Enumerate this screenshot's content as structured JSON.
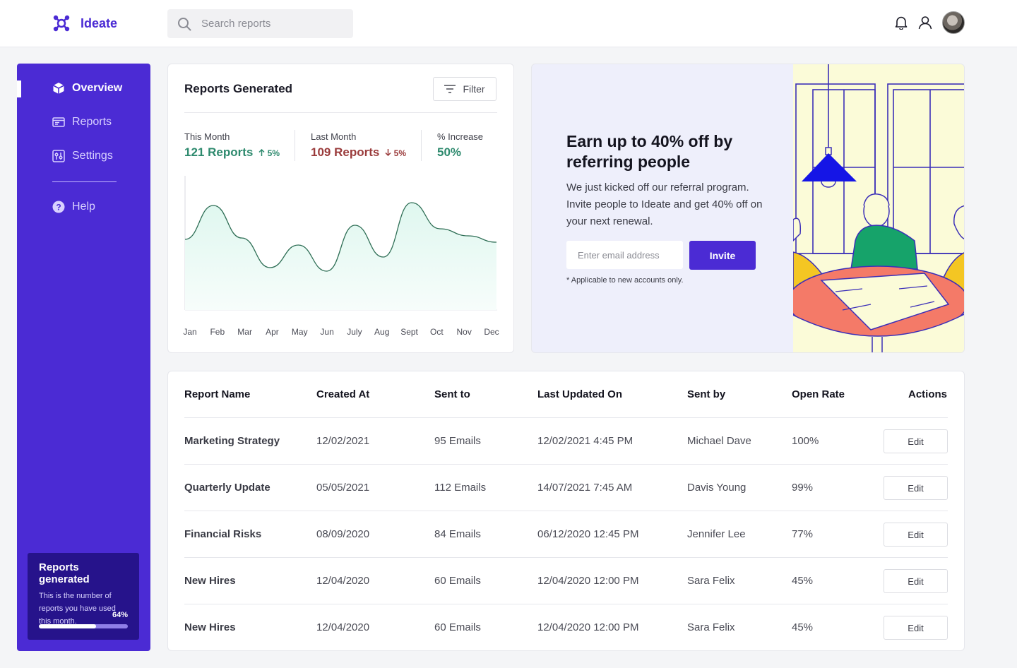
{
  "app": {
    "name": "Ideate",
    "logo_icon": "molecule-logo-icon",
    "accent": "#4b2bd4"
  },
  "search": {
    "placeholder": "Search reports",
    "icon": "search-icon"
  },
  "header_icons": [
    "bell-icon",
    "user-icon",
    "avatar"
  ],
  "sidebar": {
    "items": [
      {
        "label": "Overview",
        "icon": "cube-icon",
        "active": true
      },
      {
        "label": "Reports",
        "icon": "reports-icon",
        "active": false
      },
      {
        "label": "Settings",
        "icon": "settings-icon",
        "active": false
      },
      {
        "label": "Help",
        "icon": "help-icon",
        "active": false
      }
    ],
    "usage": {
      "title": "Reports generated",
      "description": "This is the number of reports you have used this month.",
      "percent_label": "64%",
      "percent": 64
    }
  },
  "chart_card": {
    "title": "Reports Generated",
    "filter_label": "Filter",
    "stats": [
      {
        "label": "This Month",
        "value": "121 Reports",
        "change": "5%",
        "direction": "up",
        "color": "#2e8a6e"
      },
      {
        "label": "Last Month",
        "value": "109 Reports",
        "change": "5%",
        "direction": "down",
        "color": "#9a3b3b"
      },
      {
        "label": "% Increase",
        "value": "50%",
        "color": "#2e8a6e"
      }
    ]
  },
  "chart_data": {
    "type": "area",
    "categories": [
      "Jan",
      "Feb",
      "Mar",
      "Apr",
      "May",
      "Jun",
      "July",
      "Aug",
      "Sept",
      "Oct",
      "Nov",
      "Dec"
    ],
    "values": [
      100,
      148,
      102,
      60,
      92,
      55,
      120,
      75,
      152,
      115,
      105,
      96
    ],
    "ylim": [
      0,
      190
    ],
    "grid": false,
    "line_color": "#2e6e55",
    "fill_color": "#e6f9f3"
  },
  "referral": {
    "title": "Earn up to 40% off by referring people",
    "body": "We just kicked off our referral program. Invite people to Ideate and get 40% off on your next renewal.",
    "email_placeholder": "Enter email address",
    "invite_label": "Invite",
    "note": "* Applicable to new accounts only."
  },
  "table": {
    "headers": [
      "Report Name",
      "Created At",
      "Sent to",
      "Last Updated On",
      "Sent by",
      "Open Rate",
      "Actions"
    ],
    "edit_label": "Edit",
    "rows": [
      {
        "name": "Marketing Strategy",
        "created": "12/02/2021",
        "sent_to": "95 Emails",
        "updated": "12/02/2021 4:45 PM",
        "sent_by": "Michael Dave",
        "open_rate": "100%"
      },
      {
        "name": "Quarterly Update",
        "created": "05/05/2021",
        "sent_to": "112 Emails",
        "updated": "14/07/2021 7:45 AM",
        "sent_by": "Davis Young",
        "open_rate": "99%"
      },
      {
        "name": "Financial Risks",
        "created": "08/09/2020",
        "sent_to": "84 Emails",
        "updated": "06/12/2020 12:45 PM",
        "sent_by": "Jennifer Lee",
        "open_rate": "77%"
      },
      {
        "name": "New Hires",
        "created": "12/04/2020",
        "sent_to": "60 Emails",
        "updated": "12/04/2020 12:00 PM",
        "sent_by": "Sara Felix",
        "open_rate": "45%"
      },
      {
        "name": "New Hires",
        "created": "12/04/2020",
        "sent_to": "60 Emails",
        "updated": "12/04/2020 12:00 PM",
        "sent_by": "Sara Felix",
        "open_rate": "45%"
      }
    ]
  }
}
